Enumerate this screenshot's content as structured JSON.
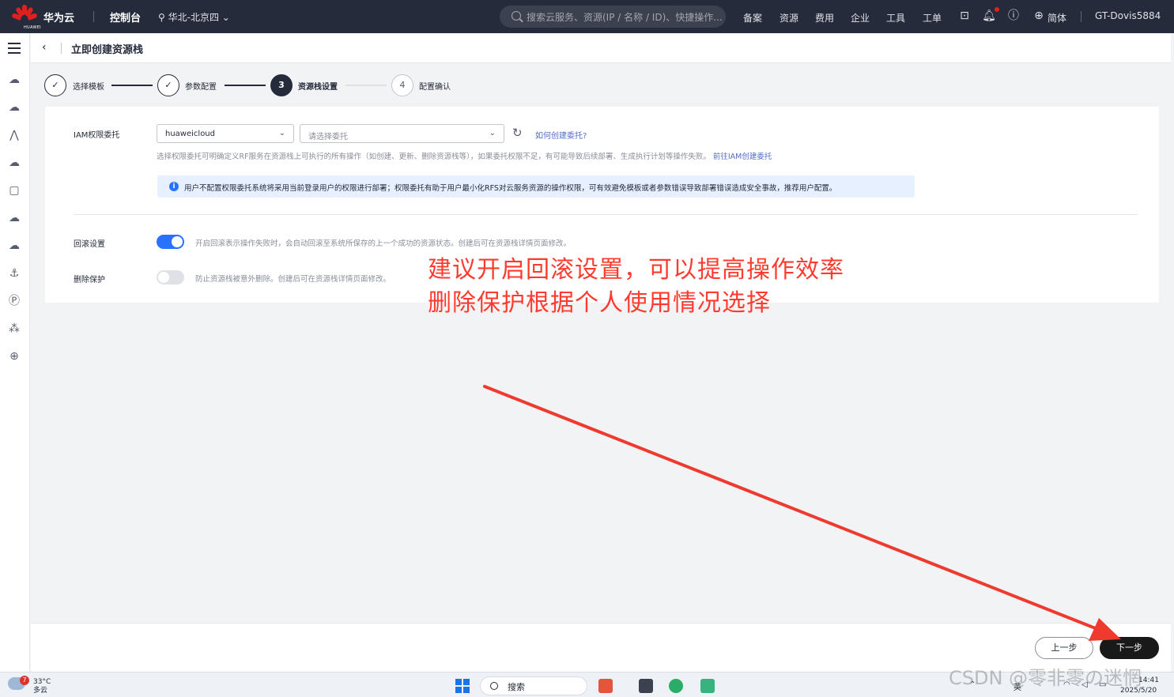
{
  "topbar": {
    "logo_text": "HUAWEI",
    "brand": "华为云",
    "console": "控制台",
    "region": "华北-北京四",
    "search_placeholder": "搜索云服务、资源(IP / 名称 / ID)、快捷操作...",
    "links": [
      "备案",
      "资源",
      "费用",
      "企业",
      "工具",
      "工单"
    ],
    "language": "简体",
    "user": "GT-Dovis5884"
  },
  "page": {
    "back_icon": "‹",
    "title": "立即创建资源栈"
  },
  "steps": [
    {
      "number": "✓",
      "label": "选择模板",
      "status": "done"
    },
    {
      "number": "✓",
      "label": "参数配置",
      "status": "done"
    },
    {
      "number": "3",
      "label": "资源栈设置",
      "status": "active"
    },
    {
      "number": "4",
      "label": "配置确认",
      "status": "todo"
    }
  ],
  "form": {
    "iam_label": "IAM权限委托",
    "provider_value": "huaweicloud",
    "agency_placeholder": "请选择委托",
    "how_to_link": "如何创建委托?",
    "iam_help": "选择权限委托可明确定义RF服务在资源栈上可执行的所有操作（如创建、更新、删除资源栈等），如果委托权限不足，有可能导致后续部署、生成执行计划等操作失败。",
    "iam_help_link": "前往IAM创建委托",
    "alert_text": "用户不配置权限委托系统将采用当前登录用户的权限进行部署；权限委托有助于用户最小化RFS对云服务资源的操作权限，可有效避免模板或者参数错误导致部署错误造成安全事故，推荐用户配置。",
    "rollback_label": "回滚设置",
    "rollback_enabled": true,
    "rollback_help": "开启回滚表示操作失败时，会自动回滚至系统所保存的上一个成功的资源状态。创建后可在资源栈详情页面修改。",
    "protect_label": "删除保护",
    "protect_enabled": false,
    "protect_help": "防止资源栈被意外删除。创建后可在资源栈详情页面修改。"
  },
  "annotation": {
    "line1": "建议开启回滚设置，可以提高操作效率",
    "line2": "删除保护根据个人使用情况选择",
    "color": "#ff3b30"
  },
  "footer": {
    "prev_label": "上一步",
    "next_label": "下一步"
  },
  "taskbar": {
    "weather_badge": "7",
    "temperature": "33°C",
    "condition": "多云",
    "search_label": "搜索",
    "ime": "英",
    "time": "14:41",
    "date": "2025/5/20"
  },
  "watermark": "CSDN @零非零の迷惘",
  "colors": {
    "topbar": "#252b3a",
    "accent": "#2971ff",
    "link": "#526ecc",
    "brand_red": "#e02020"
  }
}
